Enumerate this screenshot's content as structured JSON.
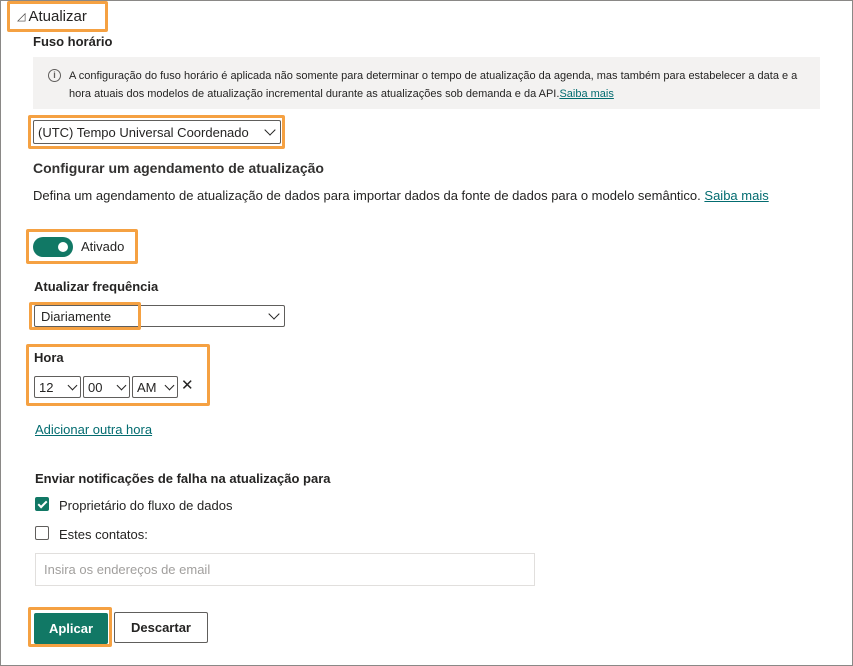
{
  "section": {
    "title": "Atualizar",
    "toggle_icon": "collapse-triangle-icon"
  },
  "timezone": {
    "label": "Fuso horário",
    "info_text": "A configuração do fuso horário é aplicada não somente para determinar o tempo de atualização da agenda, mas também para estabelecer a data e a hora atuais dos modelos de atualização incremental durante as atualizações sob demanda e da API.",
    "info_link": "Saiba mais",
    "selected": "(UTC) Tempo Universal Coordenado"
  },
  "schedule": {
    "heading": "Configurar um agendamento de atualização",
    "description": "Defina um agendamento de atualização de dados para importar dados da fonte de dados para o modelo semântico.",
    "link": "Saiba mais",
    "toggle_label": "Ativado",
    "toggle_on": true
  },
  "frequency": {
    "label": "Atualizar frequência",
    "selected": "Diariamente"
  },
  "time": {
    "label": "Hora",
    "hour": "12",
    "minute": "00",
    "ampm": "AM",
    "remove_symbol": "✕",
    "add_link": "Adicionar outra hora"
  },
  "notifications": {
    "label": "Enviar notificações de falha na atualização para",
    "owner_label": "Proprietário do fluxo de dados",
    "owner_checked": true,
    "contacts_label": "Estes contatos:",
    "contacts_checked": false,
    "email_placeholder": "Insira os endereços de email"
  },
  "buttons": {
    "apply": "Aplicar",
    "discard": "Descartar"
  },
  "colors": {
    "accent": "#117865",
    "highlight": "#f5a142",
    "info_bg": "#f3f2f1",
    "link": "#036c70"
  }
}
